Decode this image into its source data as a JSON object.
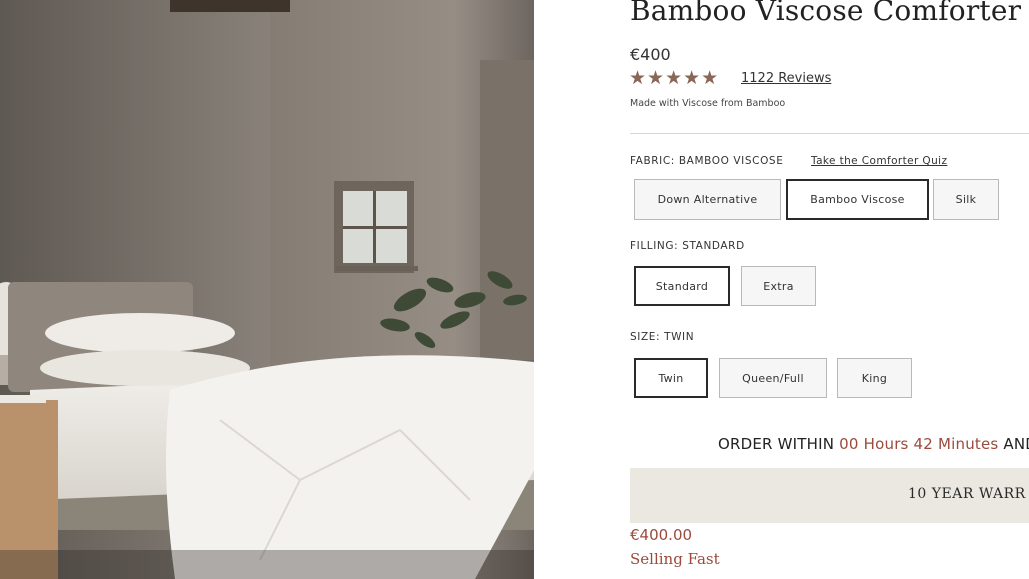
{
  "product": {
    "title": "Bamboo Viscose Comforter",
    "price": "€400",
    "rating_stars": "★★★★★",
    "reviews_link": "1122 Reviews",
    "subtitle": "Made with Viscose from Bamboo",
    "image_alt": "bedroom with white comforter"
  },
  "fabric": {
    "label": "FABRIC: BAMBOO VISCOSE",
    "quiz_link": "Take the Comforter Quiz",
    "options": [
      "Down Alternative",
      "Bamboo Viscose",
      "Silk"
    ],
    "selected": "Bamboo Viscose"
  },
  "filling": {
    "label": "FILLING: STANDARD",
    "options": [
      "Standard",
      "Extra"
    ],
    "selected": "Standard"
  },
  "size": {
    "label": "SIZE: TWIN",
    "options": [
      "Twin",
      "Queen/Full",
      "King"
    ],
    "selected": "Twin"
  },
  "order": {
    "prefix": "ORDER WITHIN ",
    "countdown": "00 Hours 42 Minutes",
    "suffix": " AND"
  },
  "warranty": "10 YEAR WARR",
  "sale_price": "€400.00",
  "stock_status": "Selling Fast",
  "colors": {
    "accent": "#9b4a3c",
    "star": "#8a6656",
    "warranty_bg": "#ebe8e1"
  }
}
